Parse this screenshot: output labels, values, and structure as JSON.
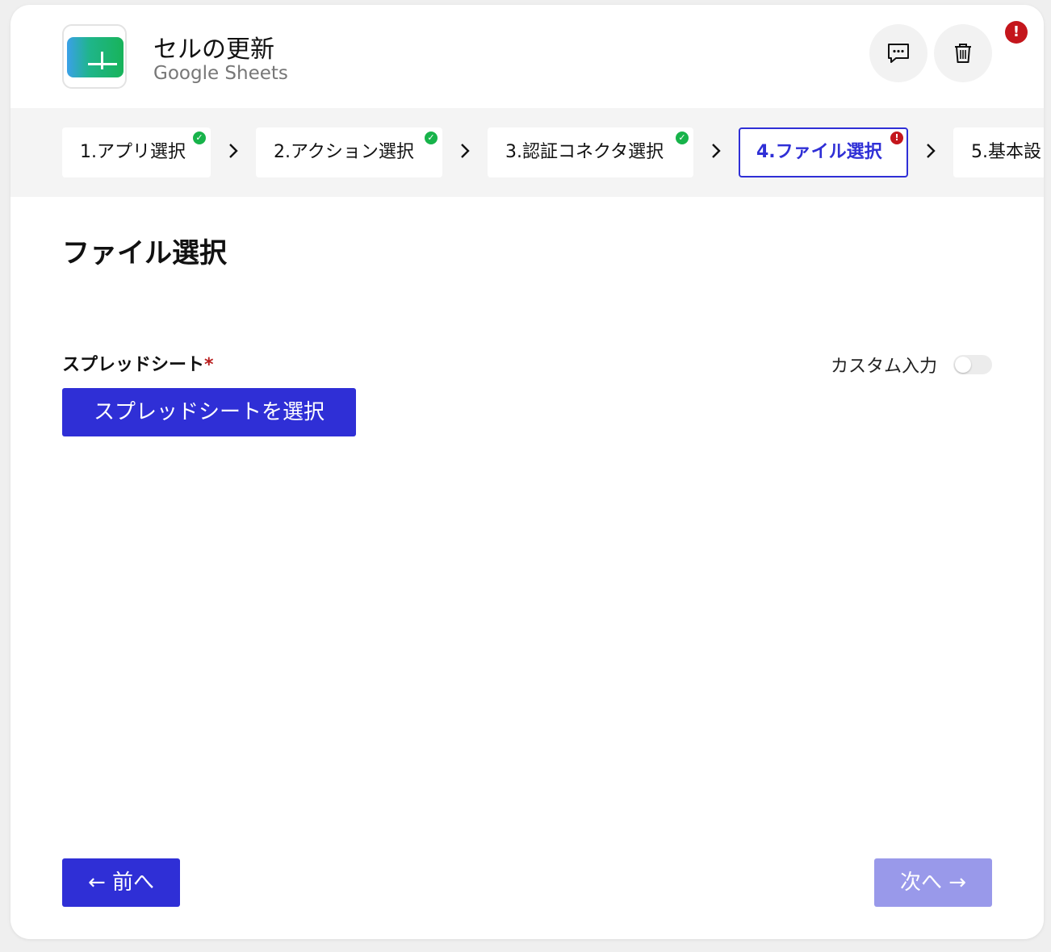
{
  "header": {
    "title": "セルの更新",
    "subtitle": "Google Sheets",
    "app_icon": "google-sheets-icon",
    "comment_icon": "comment-icon",
    "delete_icon": "trash-icon",
    "alert_badge": "!"
  },
  "stepper": {
    "steps": [
      {
        "label": "1.アプリ選択",
        "status": "complete"
      },
      {
        "label": "2.アクション選択",
        "status": "complete"
      },
      {
        "label": "3.認証コネクタ選択",
        "status": "complete"
      },
      {
        "label": "4.ファイル選択",
        "status": "error",
        "active": true
      },
      {
        "label": "5.基本設",
        "status": "pending"
      }
    ],
    "check_glyph": "✓",
    "error_glyph": "!"
  },
  "main": {
    "page_title": "ファイル選択",
    "field_label": "スプレッドシート",
    "required_mark": "*",
    "custom_input_label": "カスタム入力",
    "custom_input_enabled": false,
    "select_button_label": "スプレッドシートを選択"
  },
  "footer": {
    "prev_label": "← 前へ",
    "next_label": "次へ →",
    "next_enabled": false
  },
  "colors": {
    "primary": "#2f2fd6",
    "primary_disabled": "#9999ea",
    "success": "#17b34a",
    "error": "#c4161c"
  }
}
